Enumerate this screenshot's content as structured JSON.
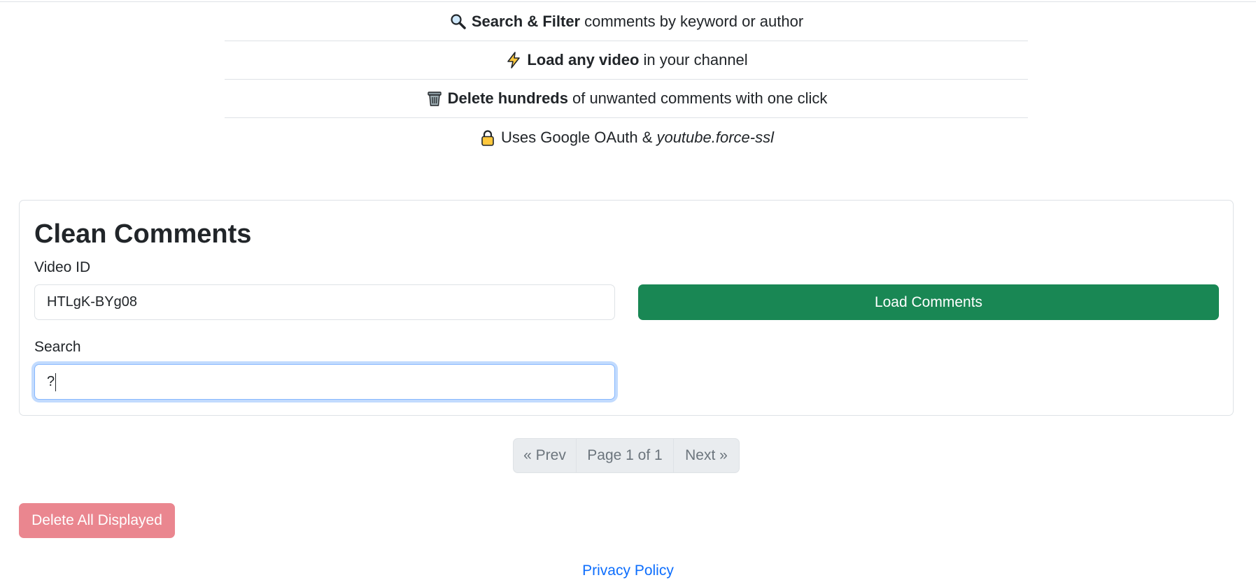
{
  "features": [
    {
      "icon": "magnifier-icon",
      "bold": "Search & Filter",
      "text": "comments by keyword or author",
      "italic": ""
    },
    {
      "icon": "lightning-icon",
      "bold": "Load any video",
      "text": "in your channel",
      "italic": ""
    },
    {
      "icon": "trash-icon",
      "bold": "Delete hundreds",
      "text": "of unwanted comments with one click",
      "italic": ""
    },
    {
      "icon": "lock-icon",
      "bold": "",
      "text": "Uses Google OAuth &",
      "italic": "youtube.force-ssl"
    }
  ],
  "card": {
    "title": "Clean Comments",
    "video_id_label": "Video ID",
    "video_id_value": "HTLgK-BYg08",
    "load_button": "Load Comments",
    "search_label": "Search",
    "search_value": "?"
  },
  "pager": {
    "prev": "« Prev",
    "info": "Page 1 of 1",
    "next": "Next »"
  },
  "delete_button": "Delete All Displayed",
  "footer": {
    "privacy_link": "Privacy Policy"
  },
  "colors": {
    "success": "#198754",
    "danger_disabled": "#ea868f",
    "link": "#0d6efd",
    "focus_border": "#86b7fe"
  }
}
